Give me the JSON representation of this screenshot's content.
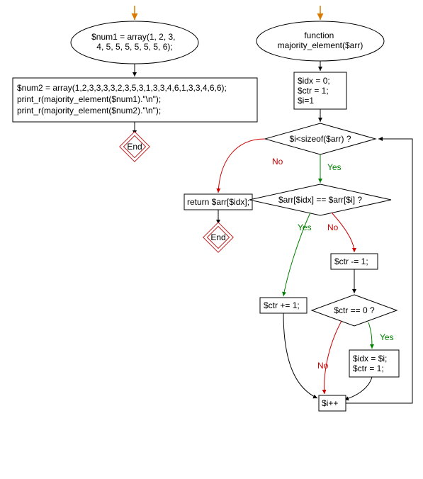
{
  "colors": {
    "arrow_orange": "#d97a00",
    "stroke": "#000000",
    "fill_box": "#ffffff",
    "end_border": "#c02020"
  },
  "main": {
    "start_assign": "$num1 = array(1, 2, 3,\n4, 5, 5, 5, 5, 5, 5, 6);",
    "code_block": "$num2 = array(1,2,3,3,3,3,2,3,5,3,1,3,3,4,6,1,3,3,4,6,6);\nprint_r(majority_element($num1).\"\\n\");\nprint_r(majority_element($num2).\"\\n\");",
    "end": "End"
  },
  "func": {
    "header": "function\nmajority_element($arr)",
    "init": "$idx = 0;\n$ctr = 1;\n$i=1",
    "cond_loop": "$i<sizeof($arr) ?",
    "ret": "return $arr[$idx];",
    "end": "End",
    "cond_eq": "$arr[$idx] == $arr[$i] ?",
    "ctr_inc": "$ctr += 1;",
    "ctr_dec": "$ctr -= 1;",
    "cond_zero": "$ctr == 0 ?",
    "reset": "$idx = $i;\n$ctr = 1;",
    "inc": "$i++",
    "yes": "Yes",
    "no": "No"
  }
}
